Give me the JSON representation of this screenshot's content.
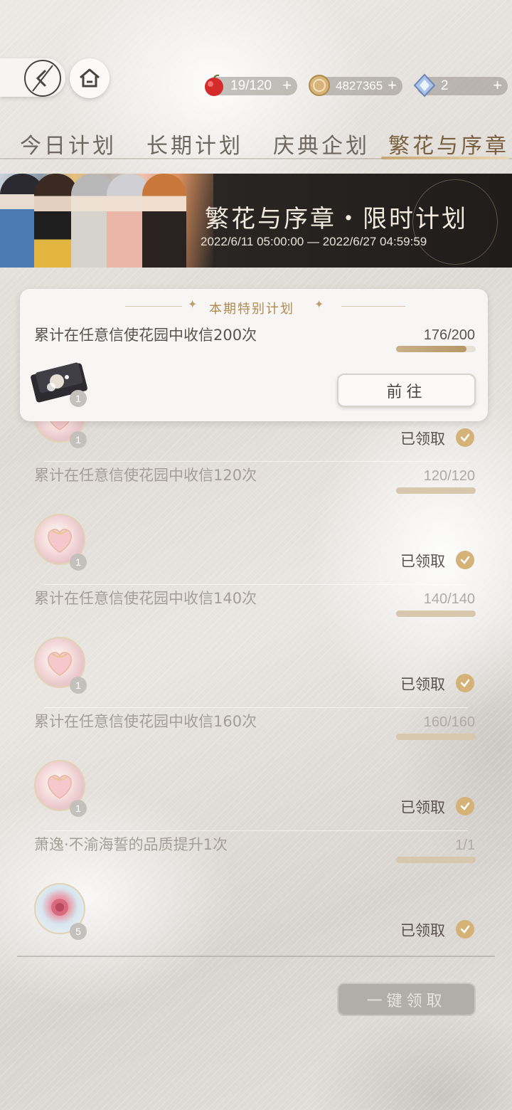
{
  "resources": [
    {
      "icon": "apple-icon",
      "value": "19/120"
    },
    {
      "icon": "coin-icon",
      "value": "4827365"
    },
    {
      "icon": "crystal-icon",
      "value": "2"
    }
  ],
  "tabs": [
    "今日计划",
    "长期计划",
    "庆典企划",
    "繁花与序章"
  ],
  "banner": {
    "title": "繁花与序章・限时计划",
    "date": "2022/6/11 05:00:00 — 2022/6/27 04:59:59"
  },
  "special": {
    "header": "本期特别计划",
    "title": "累计在任意信使花园中收信200次",
    "progress": "176/200",
    "progress_fraction": 0.88,
    "reward_count": "1",
    "button": "前往"
  },
  "tasks": [
    {
      "title": "",
      "progress": "",
      "reward_count": "1",
      "status": "已领取"
    },
    {
      "title": "累计在任意信使花园中收信120次",
      "progress": "120/120",
      "reward_count": "1",
      "status": "已领取"
    },
    {
      "title": "累计在任意信使花园中收信140次",
      "progress": "140/140",
      "reward_count": "1",
      "status": "已领取"
    },
    {
      "title": "累计在任意信使花园中收信160次",
      "progress": "160/160",
      "reward_count": "1",
      "status": "已领取"
    },
    {
      "title": "萧逸·不渝海誓的品质提升1次",
      "progress": "1/1",
      "reward_count": "5",
      "status": "已领取"
    }
  ],
  "claim_all": "一键领取",
  "colors": {
    "accent_gold": "#c8a874",
    "check_gold": "#d4b278"
  }
}
